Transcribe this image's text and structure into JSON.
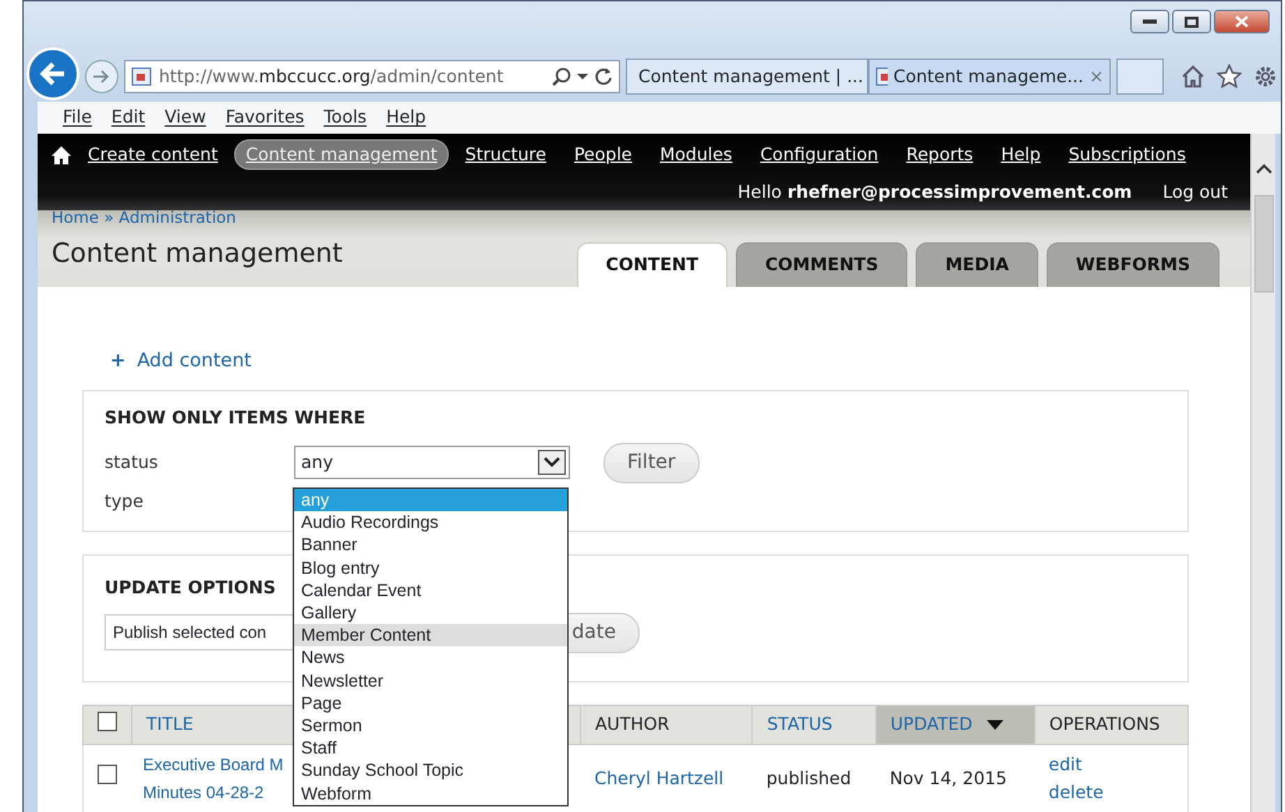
{
  "browser": {
    "address": {
      "prefix": "http://www.",
      "domain": "mbccucc.org",
      "path": "/admin/content"
    },
    "tabs": [
      {
        "label": "Content management | ...",
        "selected": false
      },
      {
        "label": "Content manageme...",
        "selected": true,
        "close": "×"
      }
    ],
    "menu": [
      "File",
      "Edit",
      "View",
      "Favorites",
      "Tools",
      "Help"
    ]
  },
  "toolbar": {
    "items": [
      {
        "label": "Create content",
        "selected": false
      },
      {
        "label": "Content management",
        "selected": true
      },
      {
        "label": "Structure",
        "selected": false
      },
      {
        "label": "People",
        "selected": false
      },
      {
        "label": "Modules",
        "selected": false
      },
      {
        "label": "Configuration",
        "selected": false
      },
      {
        "label": "Reports",
        "selected": false
      },
      {
        "label": "Help",
        "selected": false
      },
      {
        "label": "Subscriptions",
        "selected": false
      }
    ],
    "greeting": "Hello **rhefner@processimprovement.com**",
    "logout": "Log out"
  },
  "header": {
    "breadcrumb": "Home » Administration",
    "title": "Content management",
    "tabs": [
      {
        "label": "CONTENT",
        "selected": true
      },
      {
        "label": "COMMENTS",
        "selected": false
      },
      {
        "label": "MEDIA",
        "selected": false
      },
      {
        "label": "WEBFORMS",
        "selected": false
      }
    ]
  },
  "add_content": {
    "icon": "+",
    "label": "Add content"
  },
  "filter": {
    "legend": "SHOW ONLY ITEMS WHERE",
    "labels": [
      "status",
      "type"
    ],
    "status_value": "any",
    "button": "Filter",
    "dropdown": [
      {
        "label": "any",
        "selected": true,
        "hover": false
      },
      {
        "label": "Audio Recordings",
        "selected": false,
        "hover": false
      },
      {
        "label": "Banner",
        "selected": false,
        "hover": false
      },
      {
        "label": "Blog entry",
        "selected": false,
        "hover": false
      },
      {
        "label": "Calendar Event",
        "selected": false,
        "hover": false
      },
      {
        "label": "Gallery",
        "selected": false,
        "hover": false
      },
      {
        "label": "Member Content",
        "selected": false,
        "hover": true
      },
      {
        "label": "News",
        "selected": false,
        "hover": false
      },
      {
        "label": "Newsletter",
        "selected": false,
        "hover": false
      },
      {
        "label": "Page",
        "selected": false,
        "hover": false
      },
      {
        "label": "Sermon",
        "selected": false,
        "hover": false
      },
      {
        "label": "Staff",
        "selected": false,
        "hover": false
      },
      {
        "label": "Sunday School Topic",
        "selected": false,
        "hover": false
      },
      {
        "label": "Webform",
        "selected": false,
        "hover": false
      }
    ]
  },
  "update": {
    "legend": "UPDATE OPTIONS",
    "action": "Publish selected con",
    "button": "date"
  },
  "table": {
    "select_all_checked": false,
    "columns": [
      {
        "label": "TITLE",
        "sortable": true,
        "sorted": false
      },
      {
        "label": "AUTHOR",
        "sortable": false,
        "sorted": false
      },
      {
        "label": "STATUS",
        "sortable": true,
        "sorted": false
      },
      {
        "label": "UPDATED",
        "sortable": true,
        "sorted": true
      },
      {
        "label": "OPERATIONS",
        "sortable": false,
        "sorted": false
      }
    ],
    "rows": [
      {
        "checked": false,
        "title": [
          "Executive Board M",
          "Minutes 04-28-2"
        ],
        "author": "Cheryl Hartzell",
        "status": "published",
        "updated": "Nov 14, 2015",
        "operations": [
          "edit",
          "delete"
        ]
      }
    ]
  }
}
